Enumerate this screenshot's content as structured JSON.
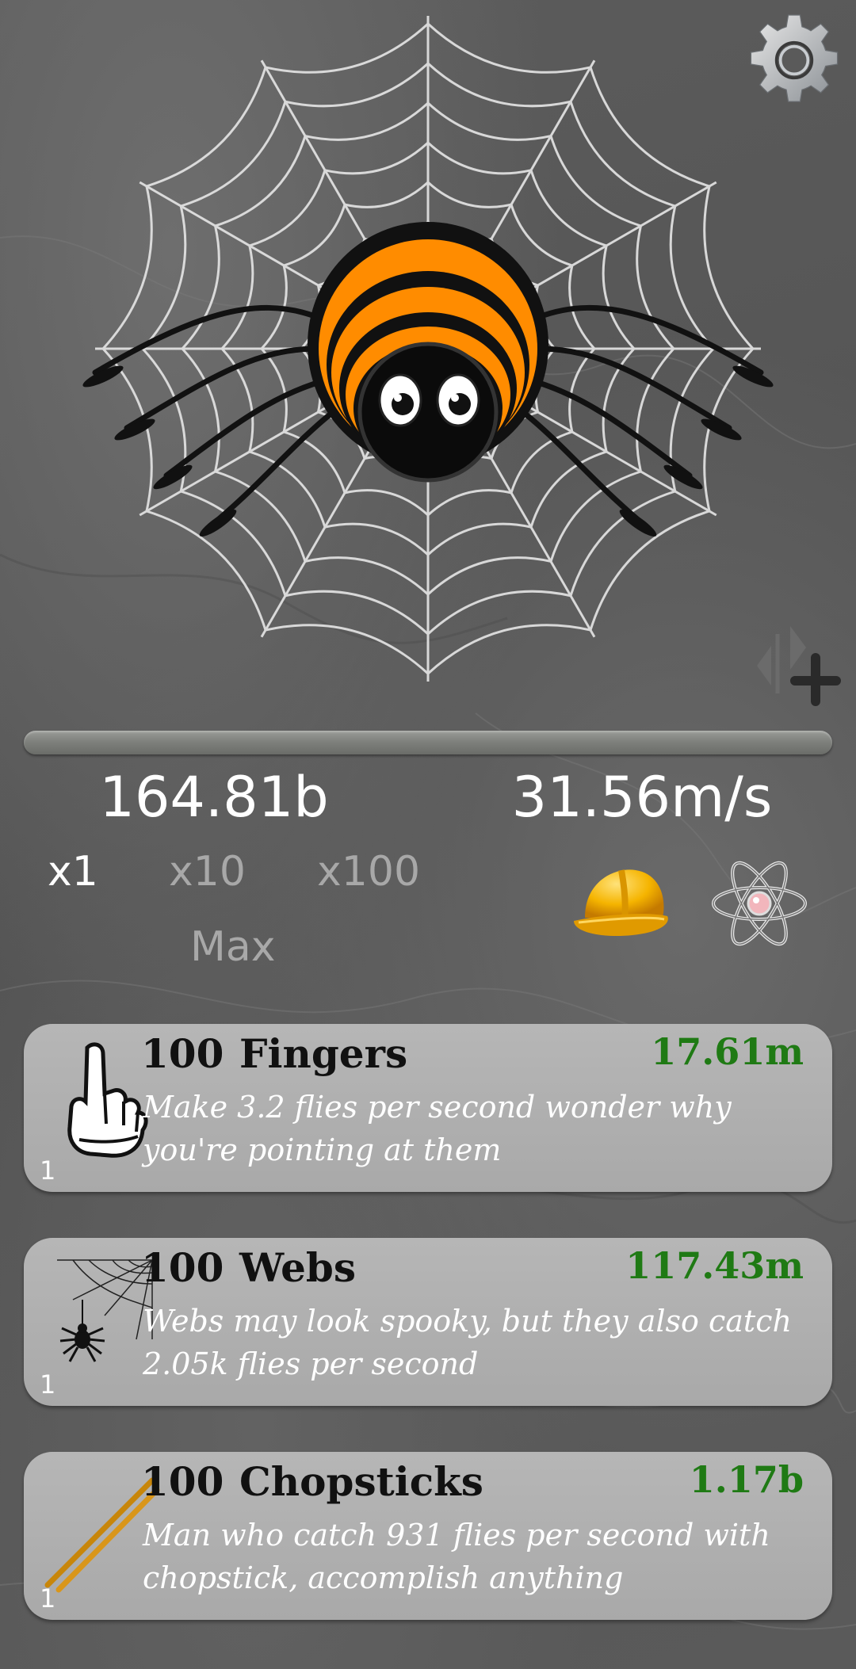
{
  "stats": {
    "flies": "164.81b",
    "rate": "31.56m/s"
  },
  "multipliers": [
    {
      "label": "x1",
      "active": true
    },
    {
      "label": "x10",
      "active": false
    },
    {
      "label": "x100",
      "active": false
    },
    {
      "label": "Max",
      "active": false
    }
  ],
  "progress": {
    "fraction": 0.0
  },
  "icons": {
    "settings": "gear-icon",
    "swap": "swap-add-icon",
    "upgrades": "helmet-icon",
    "research": "atom-icon",
    "main": "spider-on-web"
  },
  "colors": {
    "cost": "#1f7a14",
    "card_bg": "#b0b0b0",
    "spider_stripe": "#ff8c00"
  },
  "upgrades": [
    {
      "qty": "100",
      "name": "Fingers",
      "cost": "17.61m",
      "desc": "Make 3.2 flies per second wonder why you're pointing at them",
      "level": "1",
      "icon": "finger-icon"
    },
    {
      "qty": "100",
      "name": "Webs",
      "cost": "117.43m",
      "desc": "Webs may look spooky, but they also catch 2.05k flies per second",
      "level": "1",
      "icon": "web-spider-icon"
    },
    {
      "qty": "100",
      "name": "Chopsticks",
      "cost": "1.17b",
      "desc": "Man who catch 931 flies per second with chopstick, accomplish anything",
      "level": "1",
      "icon": "chopsticks-icon"
    }
  ]
}
